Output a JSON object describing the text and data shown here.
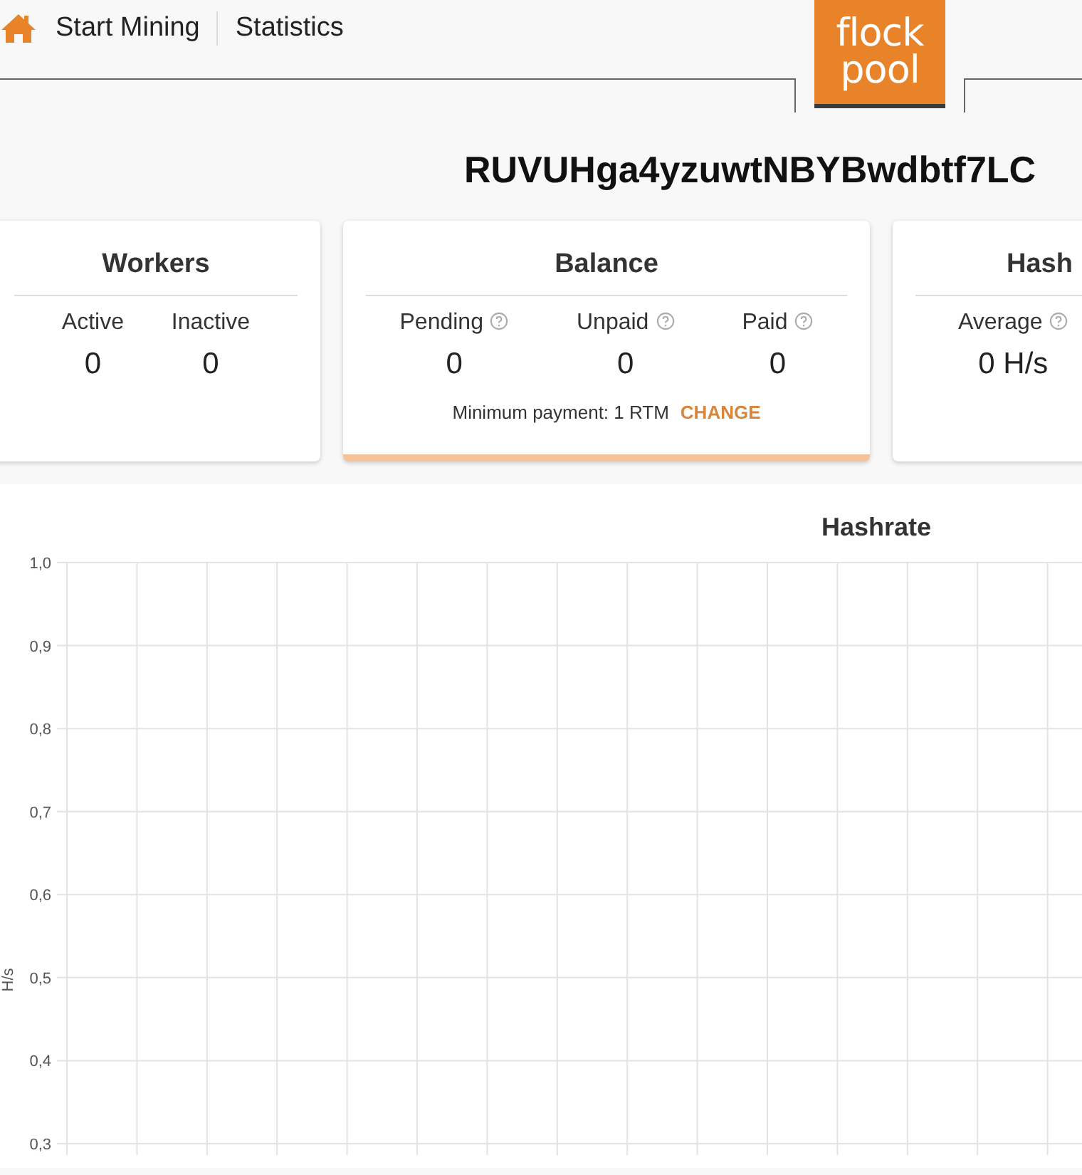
{
  "nav": {
    "items": [
      {
        "label": "Start Mining"
      },
      {
        "label": "Statistics"
      }
    ]
  },
  "logo": {
    "lines": [
      "flock",
      "pool"
    ]
  },
  "address": "RUVUHga4yzuwtNBYBwdbtf7LC",
  "cards": [
    {
      "title": "Workers",
      "highlighted": false,
      "stats": [
        {
          "label": "Active",
          "value": "0",
          "help": false
        },
        {
          "label": "Inactive",
          "value": "0",
          "help": false
        }
      ]
    },
    {
      "title": "Balance",
      "highlighted": true,
      "stats": [
        {
          "label": "Pending",
          "value": "0",
          "help": true
        },
        {
          "label": "Unpaid",
          "value": "0",
          "help": true
        },
        {
          "label": "Paid",
          "value": "0",
          "help": true
        }
      ],
      "footer": {
        "text": "Minimum payment: 1 RTM",
        "link": "CHANGE"
      }
    },
    {
      "title": "Hash",
      "highlighted": false,
      "stats": [
        {
          "label": "Average",
          "value": "0 H/s",
          "help": true
        }
      ]
    }
  ],
  "chart": {
    "chart_data": {
      "type": "line",
      "grid": true,
      "categories": [
        null,
        null,
        null,
        null,
        null,
        null,
        null,
        null,
        null,
        null,
        null,
        null,
        null,
        null,
        null
      ],
      "series": [
        {
          "values": [
            null,
            null,
            null,
            null,
            null,
            null,
            null,
            null,
            null,
            null,
            null,
            null,
            null,
            null,
            null
          ]
        }
      ],
      "title": "Hashrate",
      "ylabel": "H/s",
      "ylim": [
        0.3,
        1.0
      ],
      "yticks": [
        {
          "value": 1.0,
          "label": "1,0"
        },
        {
          "value": 0.9,
          "label": "0,9"
        },
        {
          "value": 0.8,
          "label": "0,8"
        },
        {
          "value": 0.7,
          "label": "0,7"
        },
        {
          "value": 0.6,
          "label": "0,6"
        },
        {
          "value": 0.5,
          "label": "0,5"
        },
        {
          "value": 0.4,
          "label": "0,4"
        },
        {
          "value": 0.3,
          "label": "0,3"
        }
      ]
    }
  }
}
